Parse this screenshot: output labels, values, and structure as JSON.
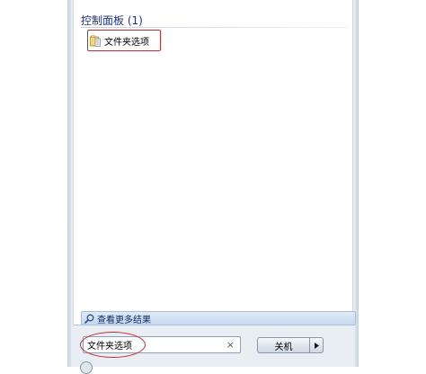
{
  "results": {
    "group_header": "控制面板 (1)",
    "items": [
      {
        "label": "文件夹选项",
        "icon": "folder-options-icon"
      }
    ]
  },
  "see_more": {
    "label": "查看更多结果",
    "icon": "search-icon"
  },
  "search": {
    "value": "文件夹选项",
    "clear_icon": "×"
  },
  "shutdown": {
    "label": "关机",
    "arrow_icon": "chevron-right-icon"
  },
  "colors": {
    "header_text": "#1e3287",
    "highlight_annotation": "#cc2b2b",
    "see_more_bg": "#c6d8ee"
  }
}
